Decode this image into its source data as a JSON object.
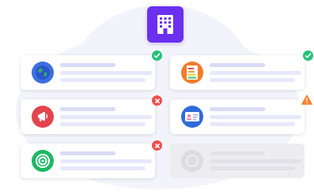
{
  "colors": {
    "hub": "#6b2ff0",
    "line_primary": "#d9dbf6",
    "line_secondary": "#e7e8fb",
    "ok": "#25c27a",
    "error": "#ef4e4e",
    "warning": "#fb7f2b"
  },
  "hub": {
    "icon": "building-icon"
  },
  "cards": [
    {
      "icon": "globe-icon",
      "icon_color": "#3d6fe0",
      "status": "success",
      "enabled": true
    },
    {
      "icon": "energy-document-icon",
      "icon_color": "#f47b2a",
      "status": "success",
      "enabled": true
    },
    {
      "icon": "megaphone-icon",
      "icon_color": "#e4444c",
      "status": "error",
      "enabled": true
    },
    {
      "icon": "id-card-icon",
      "icon_color": "#2f6bd8",
      "status": "warning",
      "enabled": true
    },
    {
      "icon": "target-icon",
      "icon_color": "#1db864",
      "status": "error",
      "enabled": true
    },
    {
      "icon": "placeholder-icon",
      "icon_color": "#dcdce2",
      "status": "none",
      "enabled": false
    }
  ]
}
